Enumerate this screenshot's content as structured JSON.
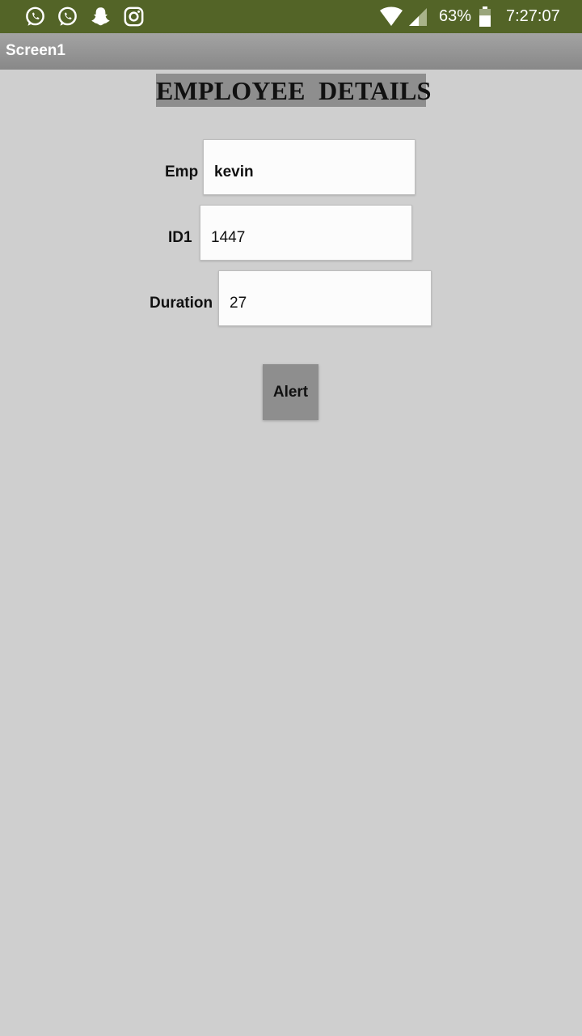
{
  "status_bar": {
    "notification_icons": [
      "whatsapp-icon",
      "whatsapp-business-icon",
      "snapchat-icon",
      "instagram-icon"
    ],
    "system_icons": [
      "wifi-icon",
      "signal-icon",
      "battery-icon"
    ],
    "battery_percent": "63%",
    "battery_level": 0.63,
    "time": "7:27:07",
    "color": "#536427"
  },
  "app_bar": {
    "title": "Screen1"
  },
  "form": {
    "heading": "EMPLOYEE  DETAILS",
    "emp": {
      "label": "Emp",
      "value": "kevin"
    },
    "id": {
      "label": "ID1",
      "value": "1447"
    },
    "duration": {
      "label": "Duration",
      "value": "27"
    },
    "alert_button": "Alert"
  }
}
